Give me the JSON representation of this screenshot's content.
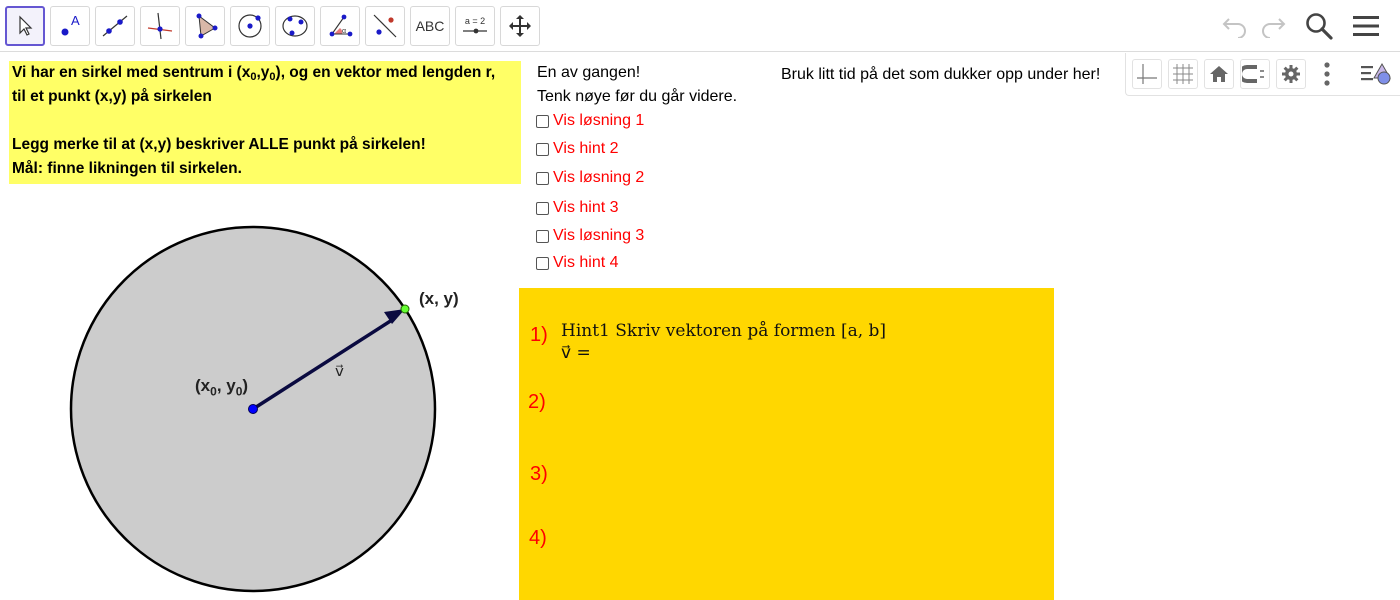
{
  "toolbar": {
    "text_tool_label": "ABC",
    "slider_tool_label": "a = 2"
  },
  "intro": {
    "line1_a": "Vi har en sirkel med sentrum i (x",
    "line1_sub1": "0",
    "line1_b": ",y",
    "line1_sub2": "0",
    "line1_c": "), og en vektor med lengden r,",
    "line2": "til et punkt (x,y) på sirkelen",
    "line3": "Legg merke til at (x,y) beskriver ALLE punkt på sirkelen!",
    "line4": "Mål: finne likningen til sirkelen."
  },
  "instructions": {
    "line1": "En av gangen!",
    "line2": "Tenk nøye før du går videre."
  },
  "note": "Bruk litt tid på det som dukker opp under her!",
  "checkboxes": [
    {
      "label": "Vis løsning 1",
      "checked": false
    },
    {
      "label": "Vis hint 2",
      "checked": false
    },
    {
      "label": "Vis løsning 2",
      "checked": false
    },
    {
      "label": "Vis hint 3",
      "checked": false
    },
    {
      "label": "Vis løsning 3",
      "checked": false
    },
    {
      "label": "Vis hint 4",
      "checked": false
    }
  ],
  "panel": {
    "numbers": [
      "1)",
      "2)",
      "3)",
      "4)"
    ],
    "hint_line1": "Hint1 Skriv vektoren på formen [a, b]",
    "hint_line2": "v⃗ ="
  },
  "graph": {
    "center_label_a": "(x",
    "center_sub1": "0",
    "center_label_b": ", y",
    "center_sub2": "0",
    "center_label_c": ")",
    "point_label": "(x, y)",
    "vector_label": "v⃗"
  },
  "colors": {
    "accent": "#6557d2",
    "intro_bg": "#ffff66",
    "panel_bg": "#ffd700",
    "checkbox_label": "#ff0000",
    "circle_fill": "#cccccc",
    "vector": "#0a0a40",
    "center_point": "#0000ff",
    "circle_point": "#66ff33"
  },
  "icons": [
    "move-arrow-icon",
    "point-icon",
    "line-icon",
    "perpendicular-line-icon",
    "polygon-icon",
    "circle-center-icon",
    "circle-three-points-icon",
    "angle-icon",
    "reflect-icon",
    "text-icon",
    "slider-icon",
    "move-graphics-view-icon",
    "undo-icon",
    "redo-icon",
    "search-icon",
    "menu-icon",
    "axes-icon",
    "grid-icon",
    "home-icon",
    "magnet-icon",
    "gear-icon",
    "more-vertical-icon",
    "algebra-view-icon"
  ]
}
